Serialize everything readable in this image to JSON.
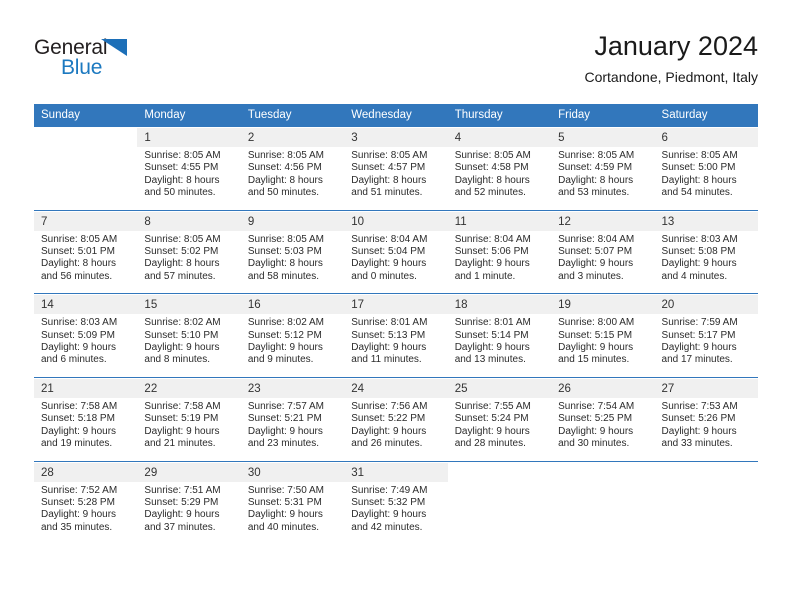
{
  "logo": {
    "word_top": "General",
    "word_bottom": "Blue",
    "triangle_icon": "triangle-icon",
    "blue": "#1c79c0",
    "dark": "#231f20"
  },
  "header": {
    "title": "January 2024",
    "subtitle": "Cortandone, Piedmont, Italy"
  },
  "theme": {
    "header_bg": "#3277bc",
    "daynum_bg": "#f0f0f0",
    "separator": "#3277bc"
  },
  "weekday_headers": [
    "Sunday",
    "Monday",
    "Tuesday",
    "Wednesday",
    "Thursday",
    "Friday",
    "Saturday"
  ],
  "labels": {
    "sunrise": "Sunrise:",
    "sunset": "Sunset:",
    "daylight": "Daylight:"
  },
  "weeks": [
    {
      "days": [
        {
          "day": "",
          "sunrise": "",
          "sunset": "",
          "daylight_line1": "",
          "daylight_line2": ""
        },
        {
          "day": "1",
          "sunrise": "Sunrise: 8:05 AM",
          "sunset": "Sunset: 4:55 PM",
          "daylight_line1": "Daylight: 8 hours",
          "daylight_line2": "and 50 minutes."
        },
        {
          "day": "2",
          "sunrise": "Sunrise: 8:05 AM",
          "sunset": "Sunset: 4:56 PM",
          "daylight_line1": "Daylight: 8 hours",
          "daylight_line2": "and 50 minutes."
        },
        {
          "day": "3",
          "sunrise": "Sunrise: 8:05 AM",
          "sunset": "Sunset: 4:57 PM",
          "daylight_line1": "Daylight: 8 hours",
          "daylight_line2": "and 51 minutes."
        },
        {
          "day": "4",
          "sunrise": "Sunrise: 8:05 AM",
          "sunset": "Sunset: 4:58 PM",
          "daylight_line1": "Daylight: 8 hours",
          "daylight_line2": "and 52 minutes."
        },
        {
          "day": "5",
          "sunrise": "Sunrise: 8:05 AM",
          "sunset": "Sunset: 4:59 PM",
          "daylight_line1": "Daylight: 8 hours",
          "daylight_line2": "and 53 minutes."
        },
        {
          "day": "6",
          "sunrise": "Sunrise: 8:05 AM",
          "sunset": "Sunset: 5:00 PM",
          "daylight_line1": "Daylight: 8 hours",
          "daylight_line2": "and 54 minutes."
        }
      ]
    },
    {
      "days": [
        {
          "day": "7",
          "sunrise": "Sunrise: 8:05 AM",
          "sunset": "Sunset: 5:01 PM",
          "daylight_line1": "Daylight: 8 hours",
          "daylight_line2": "and 56 minutes."
        },
        {
          "day": "8",
          "sunrise": "Sunrise: 8:05 AM",
          "sunset": "Sunset: 5:02 PM",
          "daylight_line1": "Daylight: 8 hours",
          "daylight_line2": "and 57 minutes."
        },
        {
          "day": "9",
          "sunrise": "Sunrise: 8:05 AM",
          "sunset": "Sunset: 5:03 PM",
          "daylight_line1": "Daylight: 8 hours",
          "daylight_line2": "and 58 minutes."
        },
        {
          "day": "10",
          "sunrise": "Sunrise: 8:04 AM",
          "sunset": "Sunset: 5:04 PM",
          "daylight_line1": "Daylight: 9 hours",
          "daylight_line2": "and 0 minutes."
        },
        {
          "day": "11",
          "sunrise": "Sunrise: 8:04 AM",
          "sunset": "Sunset: 5:06 PM",
          "daylight_line1": "Daylight: 9 hours",
          "daylight_line2": "and 1 minute."
        },
        {
          "day": "12",
          "sunrise": "Sunrise: 8:04 AM",
          "sunset": "Sunset: 5:07 PM",
          "daylight_line1": "Daylight: 9 hours",
          "daylight_line2": "and 3 minutes."
        },
        {
          "day": "13",
          "sunrise": "Sunrise: 8:03 AM",
          "sunset": "Sunset: 5:08 PM",
          "daylight_line1": "Daylight: 9 hours",
          "daylight_line2": "and 4 minutes."
        }
      ]
    },
    {
      "days": [
        {
          "day": "14",
          "sunrise": "Sunrise: 8:03 AM",
          "sunset": "Sunset: 5:09 PM",
          "daylight_line1": "Daylight: 9 hours",
          "daylight_line2": "and 6 minutes."
        },
        {
          "day": "15",
          "sunrise": "Sunrise: 8:02 AM",
          "sunset": "Sunset: 5:10 PM",
          "daylight_line1": "Daylight: 9 hours",
          "daylight_line2": "and 8 minutes."
        },
        {
          "day": "16",
          "sunrise": "Sunrise: 8:02 AM",
          "sunset": "Sunset: 5:12 PM",
          "daylight_line1": "Daylight: 9 hours",
          "daylight_line2": "and 9 minutes."
        },
        {
          "day": "17",
          "sunrise": "Sunrise: 8:01 AM",
          "sunset": "Sunset: 5:13 PM",
          "daylight_line1": "Daylight: 9 hours",
          "daylight_line2": "and 11 minutes."
        },
        {
          "day": "18",
          "sunrise": "Sunrise: 8:01 AM",
          "sunset": "Sunset: 5:14 PM",
          "daylight_line1": "Daylight: 9 hours",
          "daylight_line2": "and 13 minutes."
        },
        {
          "day": "19",
          "sunrise": "Sunrise: 8:00 AM",
          "sunset": "Sunset: 5:15 PM",
          "daylight_line1": "Daylight: 9 hours",
          "daylight_line2": "and 15 minutes."
        },
        {
          "day": "20",
          "sunrise": "Sunrise: 7:59 AM",
          "sunset": "Sunset: 5:17 PM",
          "daylight_line1": "Daylight: 9 hours",
          "daylight_line2": "and 17 minutes."
        }
      ]
    },
    {
      "days": [
        {
          "day": "21",
          "sunrise": "Sunrise: 7:58 AM",
          "sunset": "Sunset: 5:18 PM",
          "daylight_line1": "Daylight: 9 hours",
          "daylight_line2": "and 19 minutes."
        },
        {
          "day": "22",
          "sunrise": "Sunrise: 7:58 AM",
          "sunset": "Sunset: 5:19 PM",
          "daylight_line1": "Daylight: 9 hours",
          "daylight_line2": "and 21 minutes."
        },
        {
          "day": "23",
          "sunrise": "Sunrise: 7:57 AM",
          "sunset": "Sunset: 5:21 PM",
          "daylight_line1": "Daylight: 9 hours",
          "daylight_line2": "and 23 minutes."
        },
        {
          "day": "24",
          "sunrise": "Sunrise: 7:56 AM",
          "sunset": "Sunset: 5:22 PM",
          "daylight_line1": "Daylight: 9 hours",
          "daylight_line2": "and 26 minutes."
        },
        {
          "day": "25",
          "sunrise": "Sunrise: 7:55 AM",
          "sunset": "Sunset: 5:24 PM",
          "daylight_line1": "Daylight: 9 hours",
          "daylight_line2": "and 28 minutes."
        },
        {
          "day": "26",
          "sunrise": "Sunrise: 7:54 AM",
          "sunset": "Sunset: 5:25 PM",
          "daylight_line1": "Daylight: 9 hours",
          "daylight_line2": "and 30 minutes."
        },
        {
          "day": "27",
          "sunrise": "Sunrise: 7:53 AM",
          "sunset": "Sunset: 5:26 PM",
          "daylight_line1": "Daylight: 9 hours",
          "daylight_line2": "and 33 minutes."
        }
      ]
    },
    {
      "days": [
        {
          "day": "28",
          "sunrise": "Sunrise: 7:52 AM",
          "sunset": "Sunset: 5:28 PM",
          "daylight_line1": "Daylight: 9 hours",
          "daylight_line2": "and 35 minutes."
        },
        {
          "day": "29",
          "sunrise": "Sunrise: 7:51 AM",
          "sunset": "Sunset: 5:29 PM",
          "daylight_line1": "Daylight: 9 hours",
          "daylight_line2": "and 37 minutes."
        },
        {
          "day": "30",
          "sunrise": "Sunrise: 7:50 AM",
          "sunset": "Sunset: 5:31 PM",
          "daylight_line1": "Daylight: 9 hours",
          "daylight_line2": "and 40 minutes."
        },
        {
          "day": "31",
          "sunrise": "Sunrise: 7:49 AM",
          "sunset": "Sunset: 5:32 PM",
          "daylight_line1": "Daylight: 9 hours",
          "daylight_line2": "and 42 minutes."
        },
        {
          "day": "",
          "sunrise": "",
          "sunset": "",
          "daylight_line1": "",
          "daylight_line2": ""
        },
        {
          "day": "",
          "sunrise": "",
          "sunset": "",
          "daylight_line1": "",
          "daylight_line2": ""
        },
        {
          "day": "",
          "sunrise": "",
          "sunset": "",
          "daylight_line1": "",
          "daylight_line2": ""
        }
      ]
    }
  ]
}
